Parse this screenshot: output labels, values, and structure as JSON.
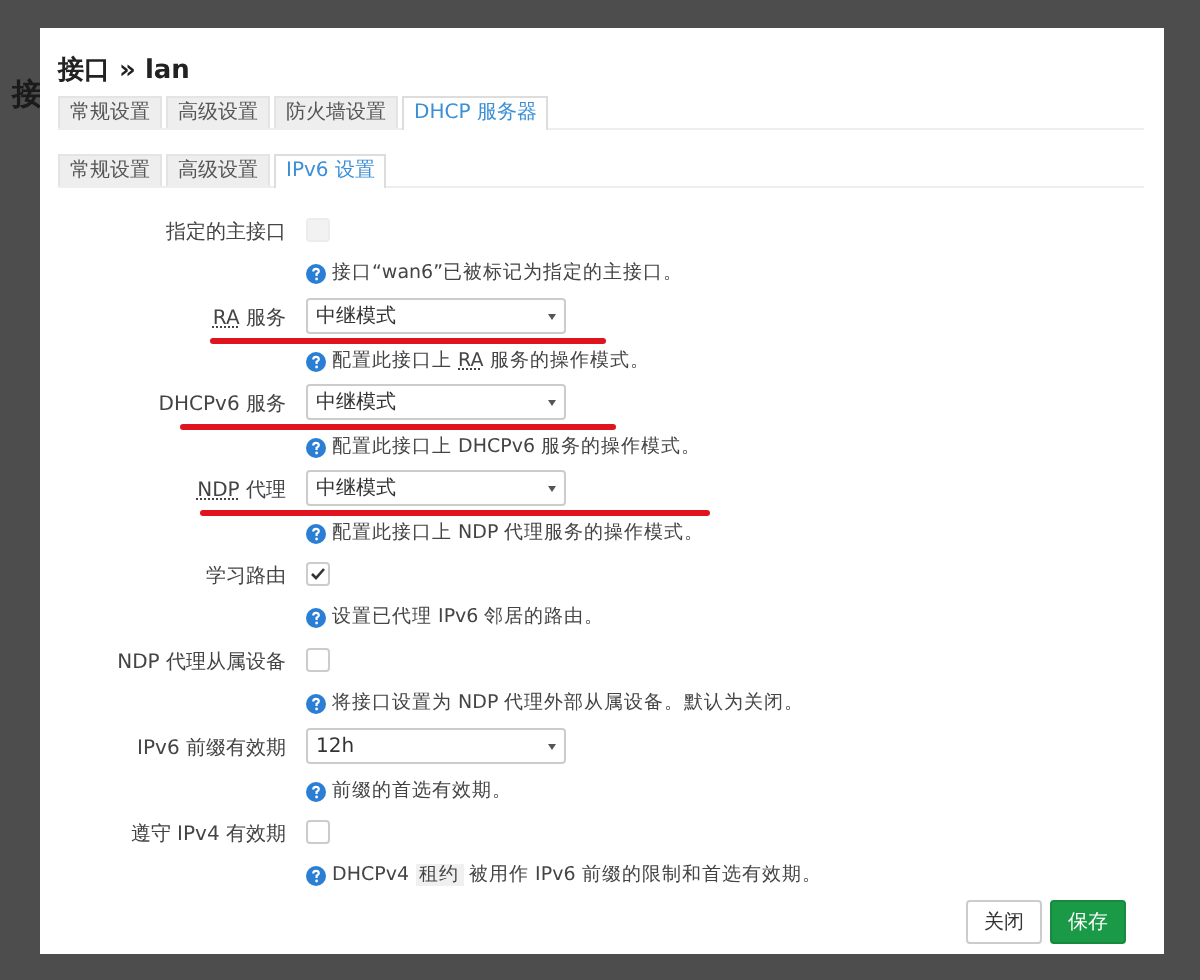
{
  "background_page": {
    "heading_fragment": "接"
  },
  "dialog": {
    "title": "接口 » lan",
    "tabs": [
      {
        "label": "常规设置",
        "selected": false
      },
      {
        "label": "高级设置",
        "selected": false
      },
      {
        "label": "防火墙设置",
        "selected": false
      },
      {
        "label": "DHCP 服务器",
        "selected": true
      }
    ],
    "subtabs": [
      {
        "label": "常规设置",
        "selected": false
      },
      {
        "label": "高级设置",
        "selected": false
      },
      {
        "label": "IPv6 设置",
        "selected": true
      }
    ],
    "fields": [
      {
        "kind": "checkbox",
        "label": [
          {
            "kind": "text",
            "text": "指定的主接口"
          }
        ],
        "checked": false,
        "disabled": true,
        "annotated": false,
        "hint": [
          {
            "kind": "text",
            "text": "接口“wan6”已被标记为指定的主接口。"
          }
        ]
      },
      {
        "kind": "select",
        "label": [
          {
            "kind": "abbr",
            "text": "RA"
          },
          {
            "kind": "text",
            "text": " 服务"
          }
        ],
        "value": "中继模式",
        "annotated": true,
        "hint": [
          {
            "kind": "text",
            "text": "配置此接口上 "
          },
          {
            "kind": "abbr",
            "text": "RA"
          },
          {
            "kind": "text",
            "text": " 服务的操作模式。"
          }
        ]
      },
      {
        "kind": "select",
        "label": [
          {
            "kind": "text",
            "text": "DHCPv6 服务"
          }
        ],
        "value": "中继模式",
        "annotated": true,
        "hint": [
          {
            "kind": "text",
            "text": "配置此接口上 DHCPv6 服务的操作模式。"
          }
        ]
      },
      {
        "kind": "select",
        "label": [
          {
            "kind": "abbr",
            "text": "NDP"
          },
          {
            "kind": "text",
            "text": " 代理"
          }
        ],
        "value": "中继模式",
        "annotated": true,
        "hint": [
          {
            "kind": "text",
            "text": "配置此接口上 NDP 代理服务的操作模式。"
          }
        ]
      },
      {
        "kind": "checkbox",
        "label": [
          {
            "kind": "text",
            "text": "学习路由"
          }
        ],
        "checked": true,
        "disabled": false,
        "annotated": false,
        "hint": [
          {
            "kind": "text",
            "text": "设置已代理 IPv6 邻居的路由。"
          }
        ]
      },
      {
        "kind": "checkbox",
        "label": [
          {
            "kind": "text",
            "text": "NDP 代理从属设备"
          }
        ],
        "checked": false,
        "disabled": false,
        "annotated": false,
        "hint": [
          {
            "kind": "text",
            "text": "将接口设置为 NDP 代理外部从属设备。默认为关闭。"
          }
        ]
      },
      {
        "kind": "select",
        "label": [
          {
            "kind": "text",
            "text": "IPv6 前缀有效期"
          }
        ],
        "value": "12h",
        "annotated": false,
        "hint": [
          {
            "kind": "text",
            "text": "前缀的首选有效期。"
          }
        ]
      },
      {
        "kind": "checkbox",
        "label": [
          {
            "kind": "text",
            "text": "遵守 IPv4 有效期"
          }
        ],
        "checked": false,
        "disabled": false,
        "annotated": false,
        "hint": [
          {
            "kind": "text",
            "text": "DHCPv4 "
          },
          {
            "kind": "code",
            "text": "租约"
          },
          {
            "kind": "text",
            "text": " 被用作 IPv6 前缀的限制和首选有效期。"
          }
        ]
      }
    ],
    "buttons": [
      {
        "label": "关闭",
        "kind": "secondary"
      },
      {
        "label": "保存",
        "kind": "primary"
      }
    ]
  }
}
